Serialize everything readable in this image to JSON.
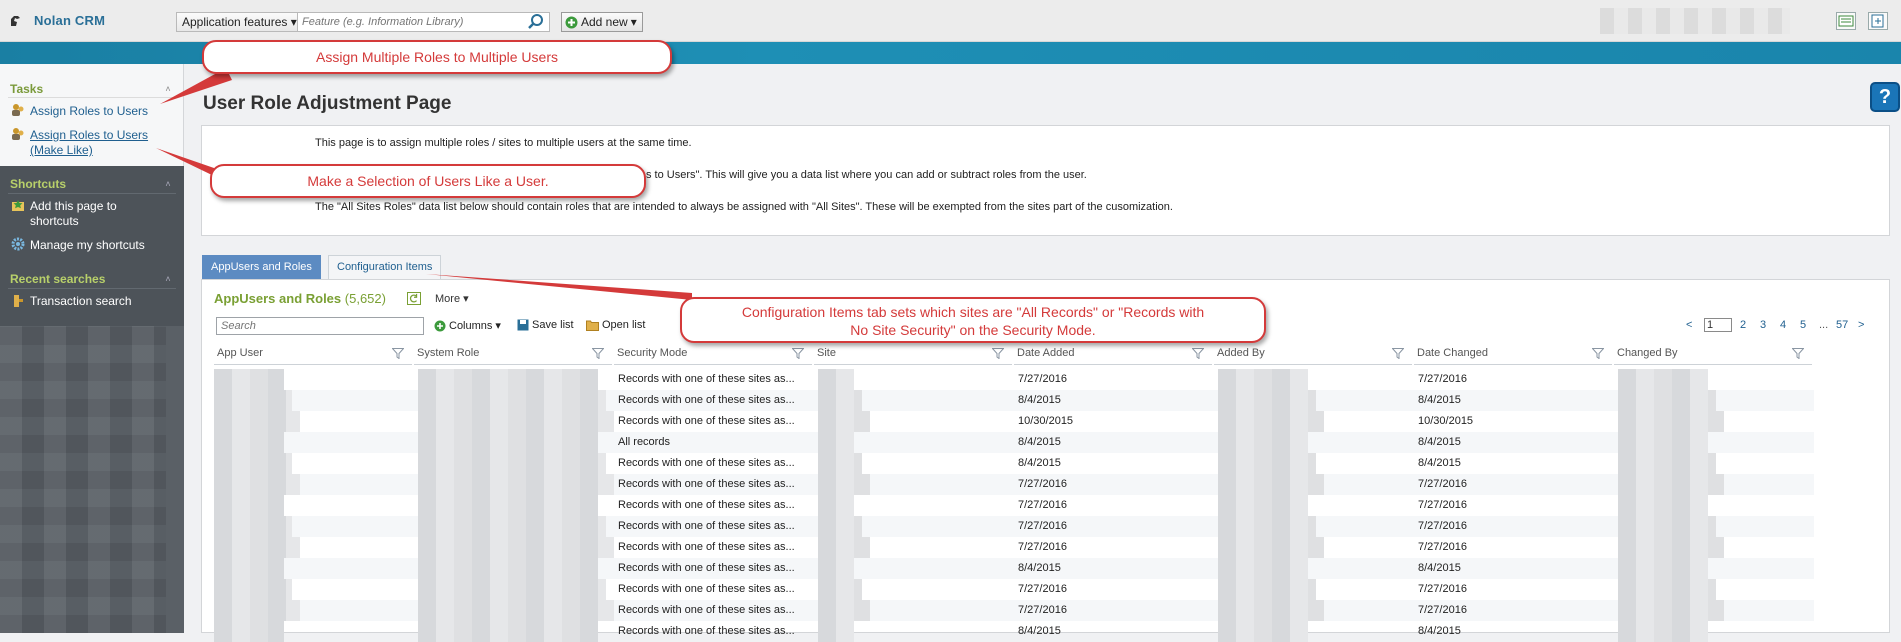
{
  "header": {
    "brand": "Nolan CRM",
    "features_select": "Application features",
    "feature_search_placeholder": "Feature (e.g. Information Library)",
    "add_new": "Add new"
  },
  "sidebar": {
    "tasks_title": "Tasks",
    "tasks": [
      {
        "label": "Assign Roles to Users"
      },
      {
        "label_line1": "Assign Roles to Users",
        "label_line2": "(Make Like)"
      }
    ],
    "shortcuts_title": "Shortcuts",
    "shortcuts": [
      {
        "label_line1": "Add this page to",
        "label_line2": "shortcuts"
      },
      {
        "label": "Manage my shortcuts"
      }
    ],
    "recent_title": "Recent searches",
    "recent": [
      {
        "label": "Transaction search"
      }
    ]
  },
  "page": {
    "title": "User Role Adjustment Page",
    "info_line1": "This page is to assign multiple roles / sites to multiple users at the same time.",
    "info_line2": "s to Users\". This will give you a data list where you can add or subtract roles from the user.",
    "info_line3": "The \"All Sites Roles\" data list below should contain roles that are intended to always be assigned with \"All Sites\". These will be exempted from the sites part of the cusomization."
  },
  "tabs": [
    {
      "label": "AppUsers and Roles",
      "active": true
    },
    {
      "label": "Configuration Items",
      "active": false
    }
  ],
  "list": {
    "title": "AppUsers and Roles",
    "count": "(5,652)",
    "more": "More",
    "search_placeholder": "Search",
    "columns_btn": "Columns",
    "save_list": "Save list",
    "open_list": "Open list",
    "pager": {
      "current": "1",
      "pages": [
        "2",
        "3",
        "4",
        "5"
      ],
      "ellipsis": "...",
      "last": "57",
      "prev": "<",
      "next": ">"
    },
    "headers": [
      "App User",
      "System Role",
      "Security Mode",
      "Site",
      "Date Added",
      "Added By",
      "Date Changed",
      "Changed By"
    ],
    "rows": [
      {
        "security_mode": "Records with one of these sites as...",
        "date_added": "7/27/2016",
        "date_changed": "7/27/2016"
      },
      {
        "security_mode": "Records with one of these sites as...",
        "date_added": "8/4/2015",
        "date_changed": "8/4/2015"
      },
      {
        "security_mode": "Records with one of these sites as...",
        "date_added": "10/30/2015",
        "date_changed": "10/30/2015"
      },
      {
        "security_mode": "All records",
        "date_added": "8/4/2015",
        "date_changed": "8/4/2015"
      },
      {
        "security_mode": "Records with one of these sites as...",
        "date_added": "8/4/2015",
        "date_changed": "8/4/2015"
      },
      {
        "security_mode": "Records with one of these sites as...",
        "date_added": "7/27/2016",
        "date_changed": "7/27/2016"
      },
      {
        "security_mode": "Records with one of these sites as...",
        "date_added": "7/27/2016",
        "date_changed": "7/27/2016"
      },
      {
        "security_mode": "Records with one of these sites as...",
        "date_added": "7/27/2016",
        "date_changed": "7/27/2016"
      },
      {
        "security_mode": "Records with one of these sites as...",
        "date_added": "7/27/2016",
        "date_changed": "7/27/2016"
      },
      {
        "security_mode": "Records with one of these sites as...",
        "date_added": "8/4/2015",
        "date_changed": "8/4/2015"
      },
      {
        "security_mode": "Records with one of these sites as...",
        "date_added": "7/27/2016",
        "date_changed": "7/27/2016"
      },
      {
        "security_mode": "Records with one of these sites as...",
        "date_added": "7/27/2016",
        "date_changed": "7/27/2016"
      },
      {
        "security_mode": "Records with one of these sites as...",
        "date_added": "8/4/2015",
        "date_changed": "8/4/2015"
      }
    ]
  },
  "callouts": {
    "c1": "Assign Multiple Roles to Multiple Users",
    "c2": "Make a Selection of Users Like a User.",
    "c3_line1": "Configuration Items tab sets which sites are \"All Records\" or \"Records with",
    "c3_line2": "No Site Security\" on the Security Mode."
  },
  "colors": {
    "accent_band": "#1a7fa3",
    "link": "#1f5f8f",
    "section_green": "#7aa034",
    "callout_red": "#d43a3a",
    "active_tab": "#5c8bc2"
  },
  "icons": [
    "app-logo-icon",
    "search-icon",
    "add-icon",
    "toolbar-report-icon",
    "toolbar-export-icon",
    "help-icon",
    "users-icon",
    "star-icon",
    "gear-icon",
    "key-icon",
    "refresh-icon",
    "plus-circle-icon",
    "save-icon",
    "folder-icon",
    "filter-icon"
  ]
}
